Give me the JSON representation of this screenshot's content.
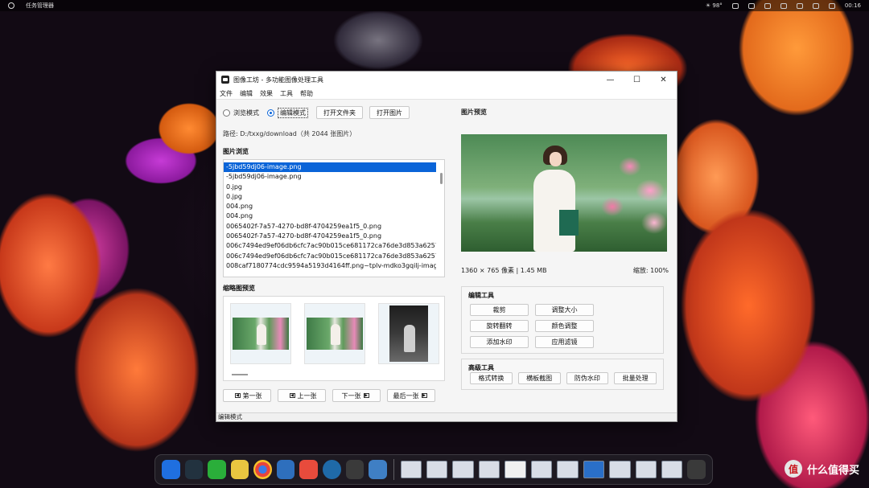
{
  "topbar": {
    "app_name": "任务管理器",
    "weather": "☀ 98°",
    "time": "00:16"
  },
  "window": {
    "title": "图像工坊 - 多功能图像处理工具",
    "controls": {
      "minimize": "—",
      "maximize": "☐",
      "close": "✕"
    },
    "menu": [
      "文件",
      "编辑",
      "效果",
      "工具",
      "帮助"
    ],
    "mode": {
      "browse_label": "浏览模式",
      "edit_label": "编辑模式",
      "selected": "edit"
    },
    "open_folder_label": "打开文件夹",
    "open_image_label": "打开图片",
    "path_text": "路径: D:/txxg/download（共 2044 张图片）",
    "file_list_title": "图片浏览",
    "files": [
      "-5jbd59dj06-image.png",
      "-5jbd59dj06-image.png",
      "0.jpg",
      "0.jpg",
      "004.png",
      "004.png",
      "0065402f-7a57-4270-bd8f-4704259ea1f5_0.png",
      "0065402f-7a57-4270-bd8f-4704259ea1f5_0.png",
      "006c7494ed9ef06db6cfc7ac90b015ce681172ca76de3d853a6257",
      "006c7494ed9ef06db6cfc7ac90b015ce681172ca76de3d853a6257",
      "008caf7180774cdc9594a5193d4164ff.png~tplv-mdko3gqilj-imag"
    ],
    "selected_file_index": 0,
    "thumbs_title": "缩略图预览",
    "nav": {
      "first": "第一张",
      "prev": "上一张",
      "next": "下一张",
      "last": "最后一张"
    },
    "preview_title": "图片预览",
    "image_info": "1360 × 765 像素  |  1.45 MB",
    "zoom_text": "缩放: 100%",
    "edit_tools_title": "编辑工具",
    "edit_tools": [
      "裁剪",
      "调整大小",
      "旋转翻转",
      "颜色调整",
      "添加水印",
      "应用滤镜"
    ],
    "advanced_tools_title": "高级工具",
    "advanced_tools": [
      "格式转换",
      "横板截图",
      "防伪水印",
      "批量处理"
    ],
    "status": "编辑模式"
  },
  "watermark": {
    "badge": "值",
    "text": "什么值得买"
  },
  "colors": {
    "selection": "#0a64d8",
    "window_bg": "#f5f5f5"
  }
}
